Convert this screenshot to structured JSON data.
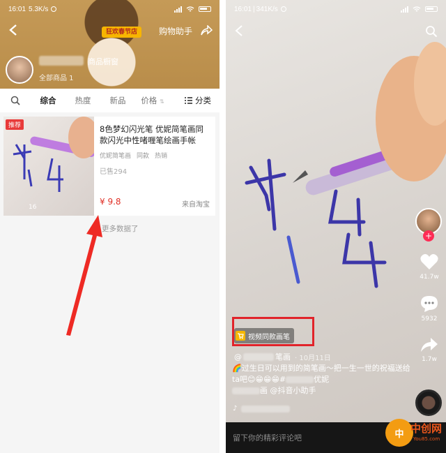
{
  "left": {
    "status": {
      "time": "16:01",
      "speed": "5.3K/s"
    },
    "header": {
      "badge": "狂欢春节店",
      "helper": "购物助手",
      "shop_title": "商品橱窗",
      "all_goods": "全部商品 1"
    },
    "tabs": [
      "综合",
      "热度",
      "新品",
      "价格"
    ],
    "category": "分类",
    "product": {
      "tag": "推荐",
      "title": "8色梦幻闪光笔 优妮简笔画同款闪光中性啫喱笔绘画手帐",
      "chips": [
        "优妮简笔画",
        "同款",
        "热销"
      ],
      "sold": "已售294",
      "price": "¥ 9.8",
      "source": "来自淘宝"
    },
    "no_more": "更多数据了"
  },
  "right": {
    "status": {
      "time": "16:01",
      "speed": "341K/s"
    },
    "likes": "41.7w",
    "comments": "5932",
    "shares": "1.7w",
    "goods_tag": "视频同款画笔",
    "author_suffix": "笔画",
    "date": "· 10月11日",
    "caption_a": "🌈过生日可以用到的简笔画～把一生一世的祝福送给ta吧😊😁😁😁#",
    "caption_b": "优妮",
    "caption_c": "画 @抖音小助手",
    "comment_placeholder": "留下你的精彩评论吧"
  },
  "watermark": {
    "logo": "中",
    "name": "中创网",
    "site": "You85.com"
  },
  "colors": {
    "price_red": "#e02e24",
    "highlight_red": "#e1232a",
    "header_gold": "#c59a57"
  }
}
